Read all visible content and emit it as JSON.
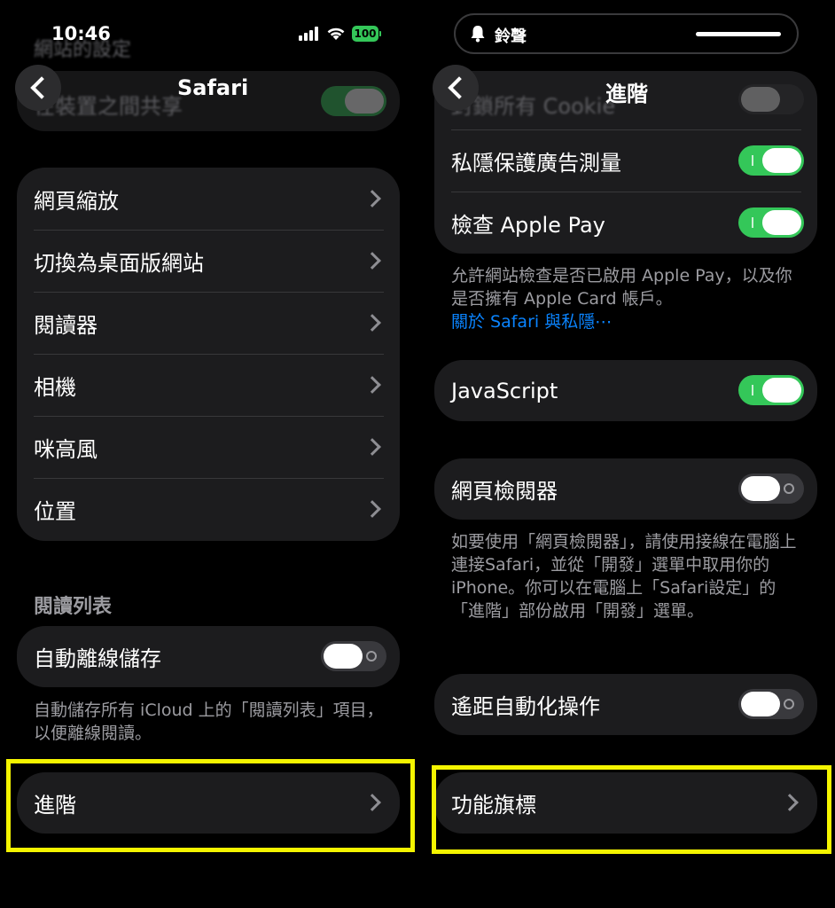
{
  "left": {
    "status": {
      "time": "10:46",
      "battery": "100"
    },
    "ghost": {
      "header": "網站的設定",
      "row": "在裝置之間共享"
    },
    "nav": {
      "title": "Safari"
    },
    "site_settings": [
      {
        "label": "網頁縮放"
      },
      {
        "label": "切換為桌面版網站"
      },
      {
        "label": "閱讀器"
      },
      {
        "label": "相機"
      },
      {
        "label": "咪高風"
      },
      {
        "label": "位置"
      }
    ],
    "reading_list": {
      "header": "閱讀列表",
      "auto_save_label": "自動離線儲存",
      "auto_save_on": false,
      "note": "自動儲存所有 iCloud 上的「閱讀列表」項目，以便離線閱讀。"
    },
    "advanced_label": "進階"
  },
  "right": {
    "notification": {
      "label": "鈴聲"
    },
    "ghost": {
      "row": "封鎖所有 Cookie"
    },
    "nav": {
      "title": "進階"
    },
    "privacy": [
      {
        "label": "私隱保護廣告測量",
        "on": true
      },
      {
        "label": "檢查 Apple Pay",
        "on": true
      }
    ],
    "apple_pay_note": "允許網站檢查是否已啟用 Apple Pay，以及你是否擁有 Apple Card 帳戶。",
    "privacy_link": "關於 Safari 與私隱⋯",
    "javascript": {
      "label": "JavaScript",
      "on": true
    },
    "web_inspector": {
      "label": "網頁檢閱器",
      "on": false,
      "note": "如要使用「網頁檢閱器」，請使用接線在電腦上連接Safari，並從「開發」選單中取用你的iPhone。你可以在電腦上「Safari設定」的「進階」部份啟用「開發」選單。"
    },
    "remote_automation": {
      "label": "遙距自動化操作",
      "on": false
    },
    "feature_flags_label": "功能旗標"
  },
  "colors": {
    "toggle_on": "#34c759",
    "link": "#0a84ff",
    "highlight": "#f4f400"
  }
}
